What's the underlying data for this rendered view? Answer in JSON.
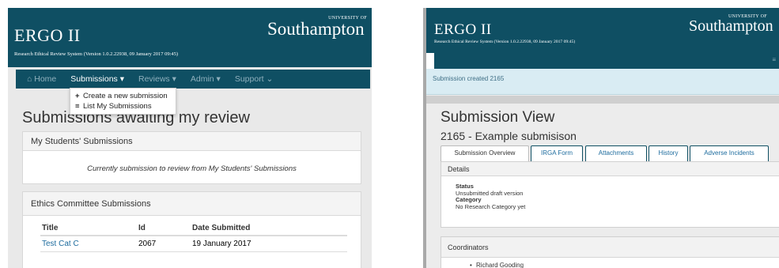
{
  "left": {
    "app_title": "ERGO II",
    "app_subtitle": "Research Ethical Review System (Version 1.0.2.22938, 09 January 2017 09:45)",
    "logo": {
      "small": "UNIVERSITY OF",
      "main": "Southampton"
    },
    "nav": [
      {
        "label": "⌂ Home"
      },
      {
        "label": "Submissions ▾"
      },
      {
        "label": "Reviews ▾"
      },
      {
        "label": "Admin ▾"
      },
      {
        "label": "Support ⌄"
      }
    ],
    "dropdown": [
      {
        "icon": "+",
        "label": "Create a new submission"
      },
      {
        "icon": "≡",
        "label": "List My Submissions"
      }
    ],
    "heading": "Submissions awaiting my review",
    "students_card": {
      "title": "My Students' Submissions",
      "message": "Currently submission to review from My Students' Submissions"
    },
    "ethics_card": {
      "title": "Ethics Committee Submissions",
      "columns": [
        "Title",
        "Id",
        "Date Submitted"
      ],
      "rows": [
        {
          "title": "Test Cat C",
          "id": "2067",
          "date": "19 January 2017"
        }
      ]
    }
  },
  "right": {
    "app_title": "ERGO II",
    "app_subtitle": "Research Ethical Review System (Version 1.0.2.22938, 09 January 2017 09:45)",
    "logo": {
      "small": "UNIVERSITY OF",
      "main": "Southampton"
    },
    "nav_fragment": "≡",
    "alert": "Submission created 2165",
    "heading": "Submission View",
    "subheading": "2165 - Example submisison",
    "tabs": [
      {
        "label": "Submission Overview"
      },
      {
        "label": "IRGA Form"
      },
      {
        "label": "Attachments"
      },
      {
        "label": "History"
      },
      {
        "label": "Adverse Incidents"
      }
    ],
    "details": {
      "title": "Details",
      "status_label": "Status",
      "status_value": "Unsubmitted draft version",
      "category_label": "Category",
      "category_value": "No Research Category yet"
    },
    "coordinators": {
      "title": "Coordinators",
      "items": [
        "Richard Gooding"
      ]
    }
  }
}
